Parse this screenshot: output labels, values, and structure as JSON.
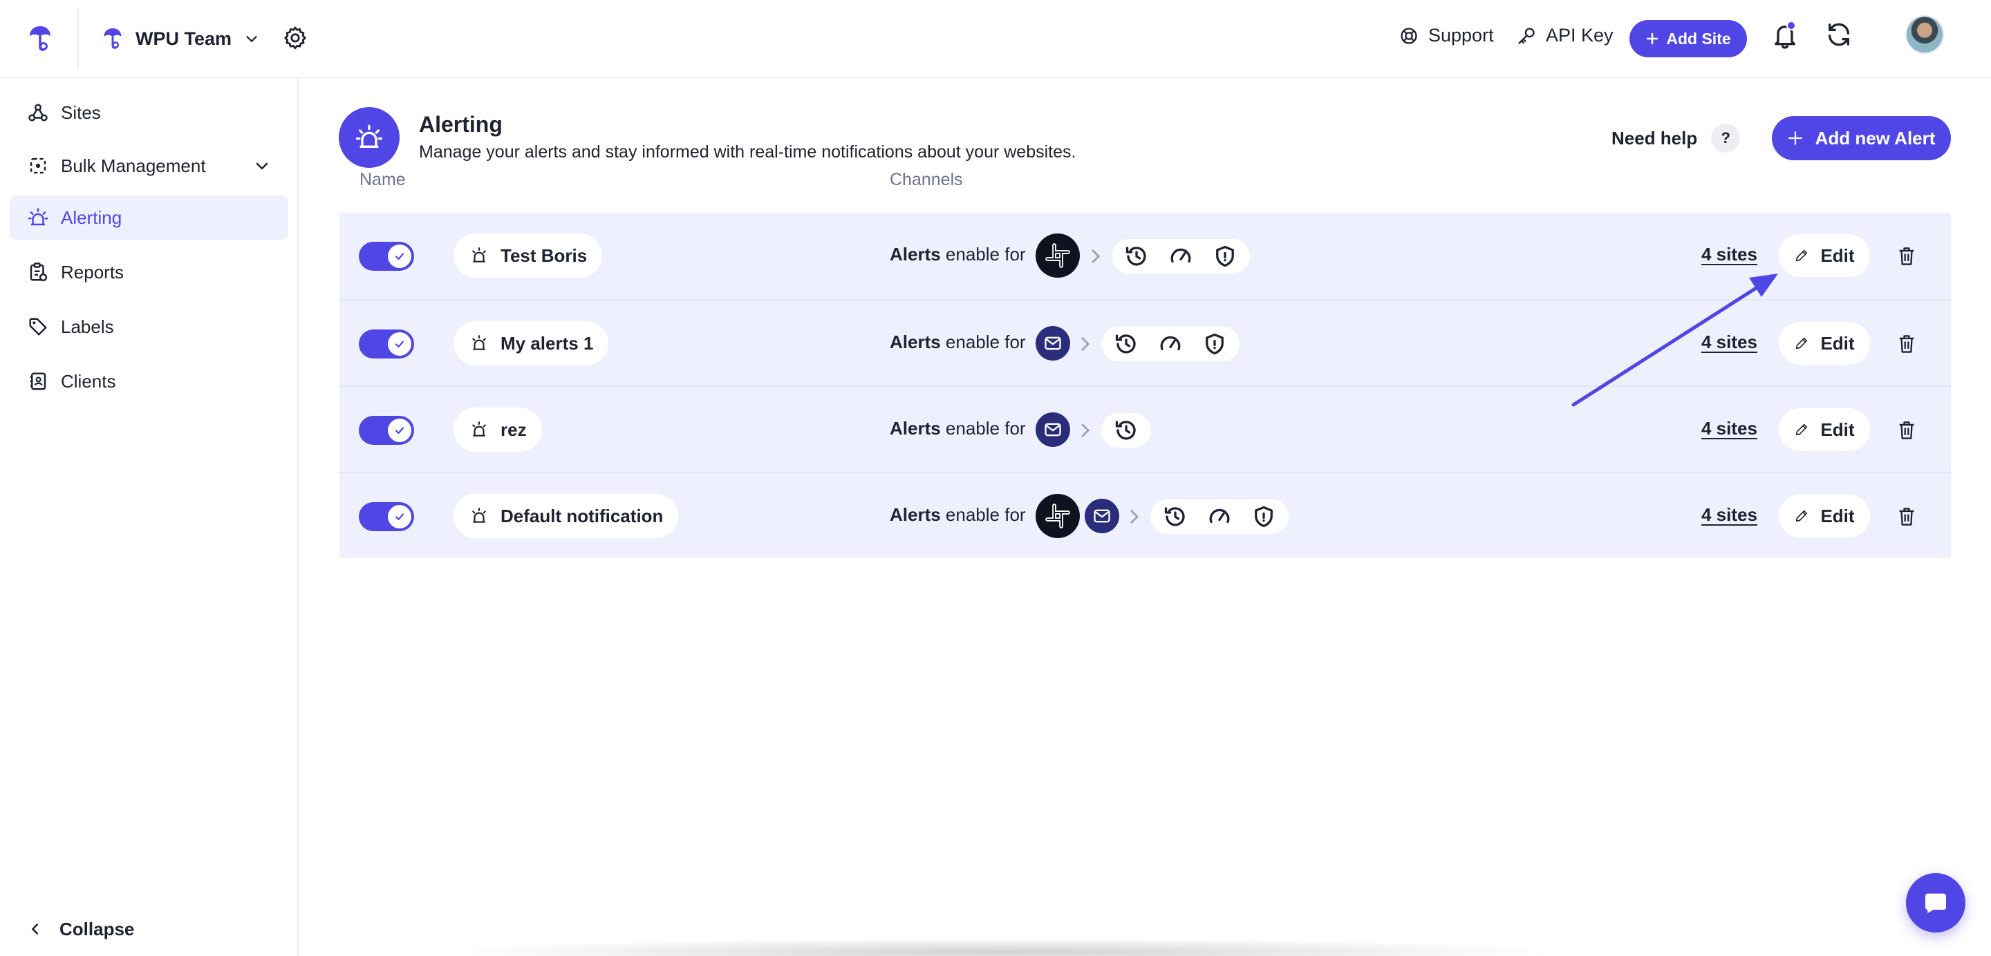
{
  "topbar": {
    "team_name": "WPU Team",
    "support_label": "Support",
    "api_key_label": "API Key",
    "add_site_label": "Add Site",
    "accent_color": "#4f46e5"
  },
  "sidebar": {
    "items": [
      {
        "label": "Sites",
        "icon": "sites-icon"
      },
      {
        "label": "Bulk Management",
        "icon": "bulk-management-icon"
      },
      {
        "label": "Alerting",
        "icon": "alarm-icon",
        "active": true
      },
      {
        "label": "Reports",
        "icon": "reports-icon"
      },
      {
        "label": "Labels",
        "icon": "tag-icon"
      },
      {
        "label": "Clients",
        "icon": "contacts-icon"
      }
    ],
    "collapse_label": "Collapse"
  },
  "header": {
    "title": "Alerting",
    "subtitle": "Manage your alerts and stay informed with real-time notifications about your websites.",
    "need_help_label": "Need help",
    "help_symbol": "?",
    "add_alert_label": "Add new Alert"
  },
  "columns": {
    "name": "Name",
    "channels": "Channels"
  },
  "alerts": [
    {
      "name": "Test Boris",
      "enabled": true,
      "channels": [
        "slack"
      ],
      "types": [
        "history",
        "performance",
        "security"
      ],
      "sites": "4 sites",
      "edit_label": "Edit"
    },
    {
      "name": "My alerts 1",
      "enabled": true,
      "channels": [
        "email"
      ],
      "types": [
        "history",
        "performance",
        "security"
      ],
      "sites": "4 sites",
      "edit_label": "Edit"
    },
    {
      "name": "rez",
      "enabled": true,
      "channels": [
        "email"
      ],
      "types": [
        "history"
      ],
      "sites": "4 sites",
      "edit_label": "Edit"
    },
    {
      "name": "Default notification",
      "enabled": true,
      "channels": [
        "slack",
        "email"
      ],
      "types": [
        "history",
        "performance",
        "security"
      ],
      "sites": "4 sites",
      "edit_label": "Edit"
    }
  ],
  "alerts_text": {
    "bold": "Alerts",
    "rest": " enable for"
  }
}
